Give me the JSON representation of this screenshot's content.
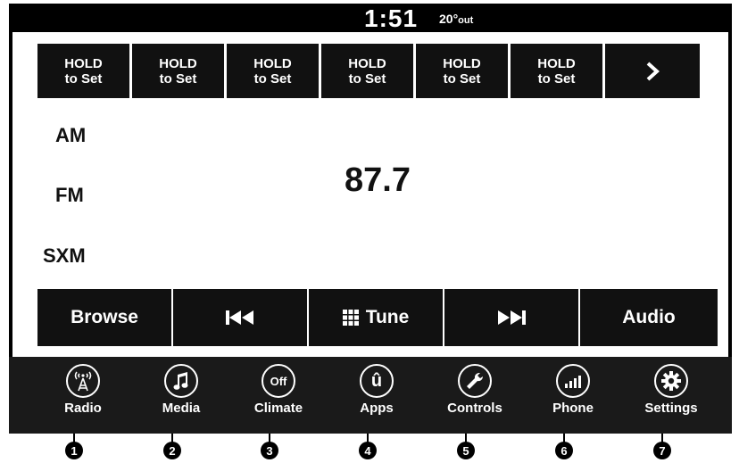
{
  "status": {
    "time": "1:51",
    "temp": "20°",
    "temp_suffix": "out"
  },
  "presets": [
    {
      "line1": "HOLD",
      "line2": "to Set"
    },
    {
      "line1": "HOLD",
      "line2": "to Set"
    },
    {
      "line1": "HOLD",
      "line2": "to Set"
    },
    {
      "line1": "HOLD",
      "line2": "to Set"
    },
    {
      "line1": "HOLD",
      "line2": "to Set"
    },
    {
      "line1": "HOLD",
      "line2": "to Set"
    }
  ],
  "presets_next_icon": "chevron-right-icon",
  "bands": {
    "am": "AM",
    "fm": "FM",
    "sxm": "SXM"
  },
  "frequency": "87.7",
  "controls": {
    "browse": "Browse",
    "tune": "Tune",
    "audio": "Audio"
  },
  "nav": [
    {
      "label": "Radio",
      "icon": "radio-tower-icon"
    },
    {
      "label": "Media",
      "icon": "music-note-icon"
    },
    {
      "label": "Climate",
      "icon": "climate-off-icon",
      "icon_text": "Off"
    },
    {
      "label": "Apps",
      "icon": "uconnect-apps-icon",
      "icon_text": "û"
    },
    {
      "label": "Controls",
      "icon": "wrench-icon"
    },
    {
      "label": "Phone",
      "icon": "phone-signal-icon"
    },
    {
      "label": "Settings",
      "icon": "gear-icon"
    }
  ],
  "callouts": [
    "1",
    "2",
    "3",
    "4",
    "5",
    "6",
    "7"
  ]
}
